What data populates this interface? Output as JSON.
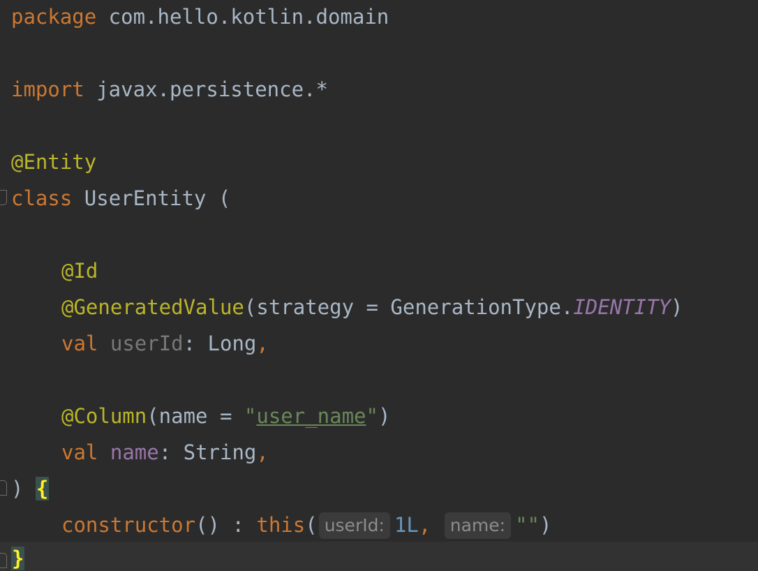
{
  "code": {
    "line1": {
      "kw": "package",
      "rest": " com.hello.kotlin.domain"
    },
    "line2": {
      "kw": "import",
      "rest": " javax.persistence.*"
    },
    "line3": {
      "annotation": "@Entity"
    },
    "line4": {
      "kw": "class",
      "rest": " UserEntity ("
    },
    "line5": {
      "annotation": "@Id"
    },
    "line6": {
      "annotation": "@GeneratedValue",
      "open": "(strategy = GenerationType.",
      "const": "IDENTITY",
      "close": ")"
    },
    "line7": {
      "kw": "val",
      "name": "userId",
      "rest": ": Long",
      "comma": ","
    },
    "line8": {
      "annotation": "@Column",
      "open": "(name = ",
      "quote_open": "\"",
      "string": "user_name",
      "quote_close": "\"",
      "close": ")"
    },
    "line9": {
      "kw": "val",
      "name": "name",
      "rest": ": String",
      "comma": ","
    },
    "line10": {
      "paren": ") ",
      "brace": "{"
    },
    "line11": {
      "kw": "constructor",
      "rest": "() : ",
      "this_kw": "this",
      "open": "(",
      "hint1": "userId:",
      "num": "1L",
      "comma": ",",
      "hint2": "name:",
      "string": "\"\"",
      "close": ")"
    },
    "line12": {
      "brace": "}"
    }
  }
}
